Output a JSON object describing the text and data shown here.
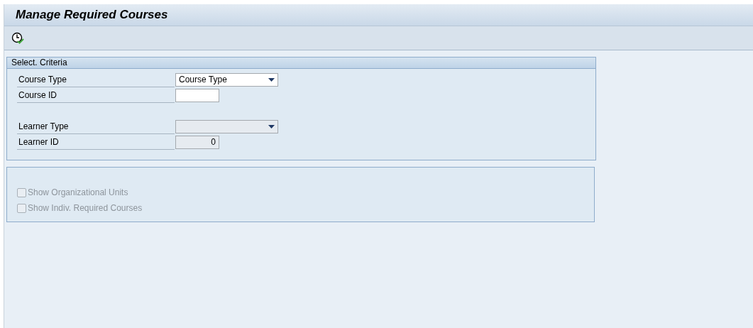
{
  "window": {
    "title": "Manage Required Courses"
  },
  "criteria": {
    "title": "Select. Criteria",
    "field_groups": [
      {
        "fields": [
          {
            "label": "Course Type",
            "kind": "dropdown",
            "value": "Course Type",
            "disabled": false
          },
          {
            "label": "Course ID",
            "kind": "input",
            "disabled": false
          }
        ]
      },
      {
        "fields": [
          {
            "label": "Learner Type",
            "kind": "dropdown",
            "disabled": true
          },
          {
            "label": "Learner ID",
            "kind": "input",
            "value": "0",
            "disabled": true
          }
        ]
      }
    ]
  },
  "options": [
    {
      "label": "Show Organizational Units",
      "checked": false,
      "disabled": true
    },
    {
      "label": "Show Indiv. Required Courses",
      "checked": false,
      "disabled": true
    }
  ]
}
